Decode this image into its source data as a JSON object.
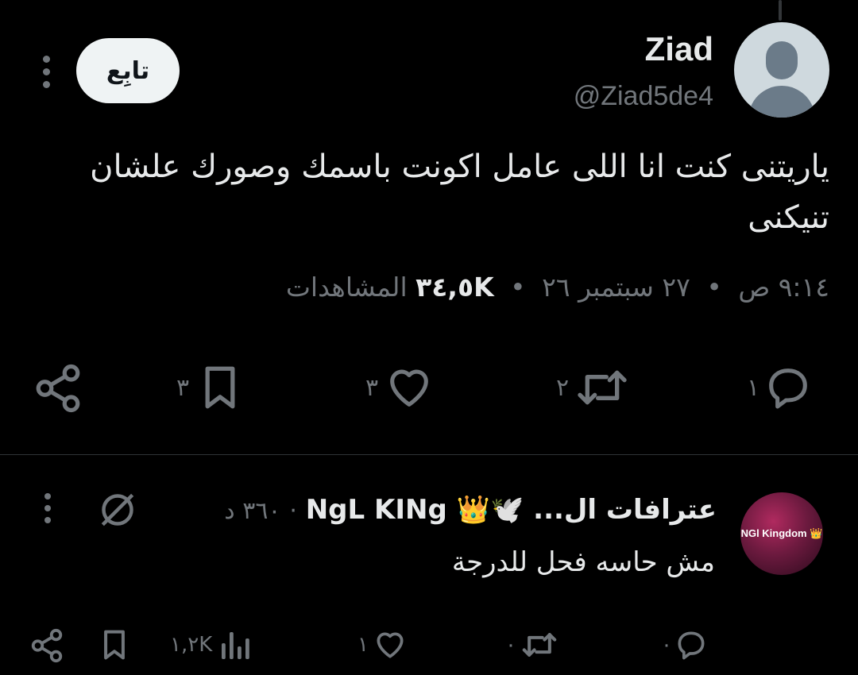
{
  "tweet": {
    "display_name": "Ziad",
    "handle": "@Ziad5de4",
    "follow_label": "تابِع",
    "text": "ياريتنى كنت انا اللى عامل اكونت باسمك وصورك علشان تنيكنى",
    "time": "٩:١٤ ص",
    "date": "٢٧ سبتمبر ٢٦",
    "views_count": "٣٤,٥K",
    "views_label": "المشاهدات",
    "separator": "•",
    "actions": {
      "reply_count": "١",
      "retweet_count": "٢",
      "like_count": "٣",
      "bookmark_count": "٣"
    }
  },
  "reply": {
    "avatar_label": "NGl Kingdom 👑",
    "display_name": "عترافات ال... 🕊️👑 NgL KINg",
    "separator": "·",
    "time_ago": "٣٦٠ د",
    "text": "مش حاسه فحل للدرجة",
    "actions": {
      "reply_count": "٠",
      "retweet_count": "٠",
      "like_count": "١",
      "views_count": "١,٢K"
    }
  },
  "colors": {
    "background": "#000000",
    "primary_text": "#e7e9ea",
    "secondary_text": "#71767b",
    "divider": "#2f3336",
    "follow_button_bg": "#eff3f4"
  },
  "icons": [
    "more-vertical-icon",
    "reply-icon",
    "retweet-icon",
    "like-icon",
    "bookmark-icon",
    "share-icon",
    "views-icon",
    "mute-icon",
    "crown-icon",
    "dove-icon"
  ]
}
